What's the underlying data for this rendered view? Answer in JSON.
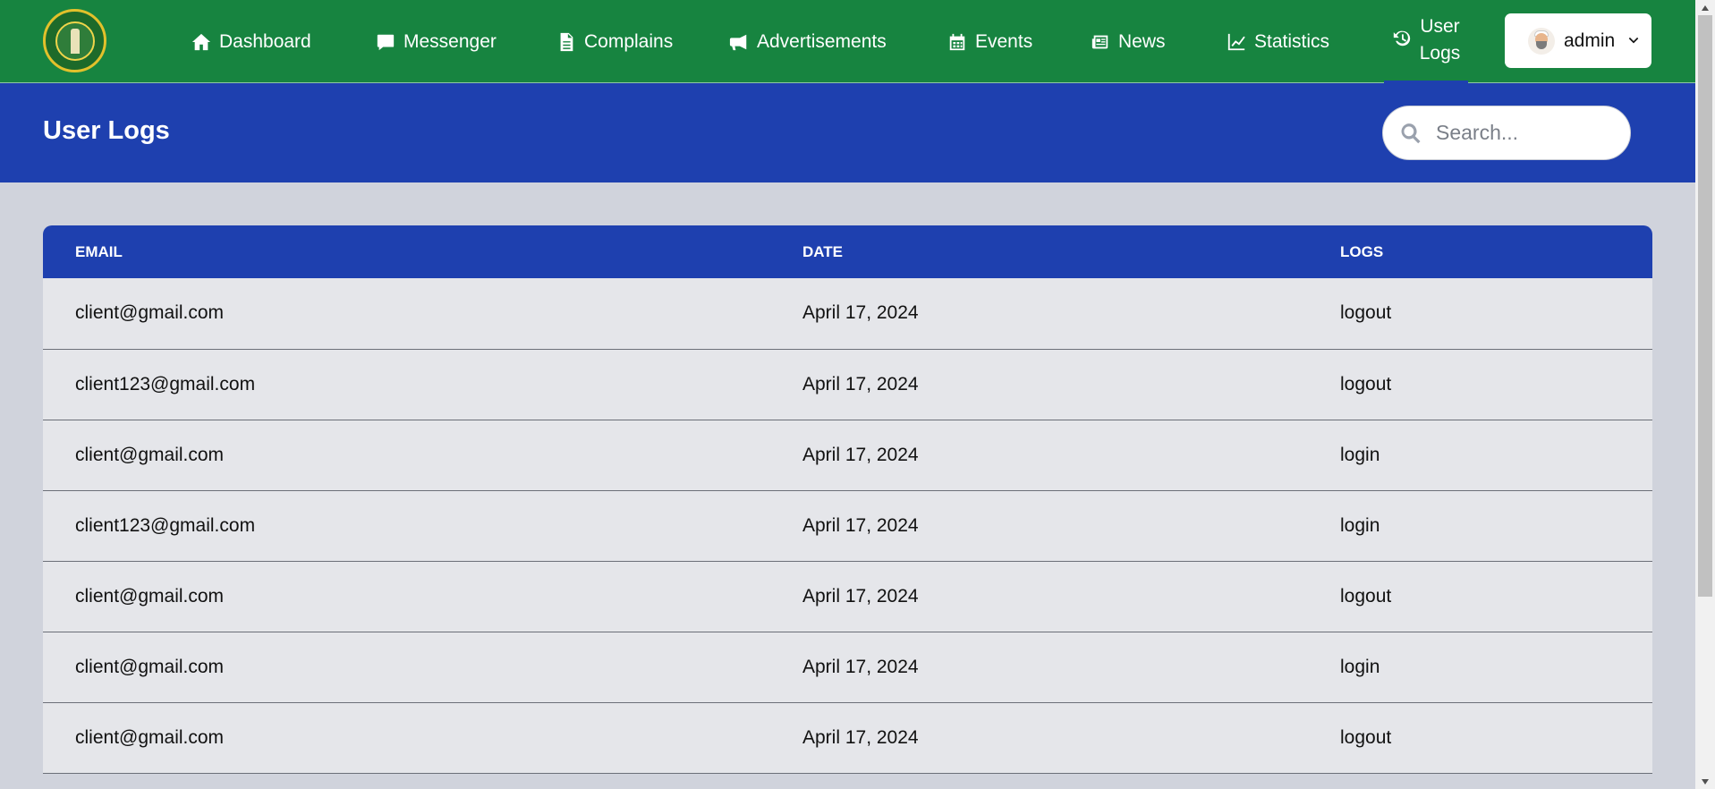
{
  "nav": {
    "items": [
      {
        "label": "Dashboard",
        "icon": "home-icon"
      },
      {
        "label": "Messenger",
        "icon": "chat-icon"
      },
      {
        "label": "Complains",
        "icon": "document-icon"
      },
      {
        "label": "Advertisements",
        "icon": "megaphone-icon"
      },
      {
        "label": "Events",
        "icon": "calendar-icon"
      },
      {
        "label": "News",
        "icon": "newspaper-icon"
      },
      {
        "label": "Statistics",
        "icon": "line-chart-icon"
      }
    ],
    "user_logs": {
      "line1": "User",
      "line2": "Logs",
      "icon": "history-icon"
    },
    "admin_label": "admin"
  },
  "header": {
    "title": "User Logs",
    "search_placeholder": "Search..."
  },
  "table": {
    "columns": [
      "EMAIL",
      "DATE",
      "LOGS"
    ],
    "rows": [
      {
        "email": "client@gmail.com",
        "date": "April 17, 2024",
        "log": "logout"
      },
      {
        "email": "client123@gmail.com",
        "date": "April 17, 2024",
        "log": "logout"
      },
      {
        "email": "client@gmail.com",
        "date": "April 17, 2024",
        "log": "login"
      },
      {
        "email": "client123@gmail.com",
        "date": "April 17, 2024",
        "log": "login"
      },
      {
        "email": "client@gmail.com",
        "date": "April 17, 2024",
        "log": "logout"
      },
      {
        "email": "client@gmail.com",
        "date": "April 17, 2024",
        "log": "login"
      },
      {
        "email": "client@gmail.com",
        "date": "April 17, 2024",
        "log": "logout"
      }
    ]
  },
  "colors": {
    "navbar": "#178440",
    "header": "#1e40af",
    "page_bg": "#d0d3dc",
    "row_bg": "#e5e6ea"
  }
}
